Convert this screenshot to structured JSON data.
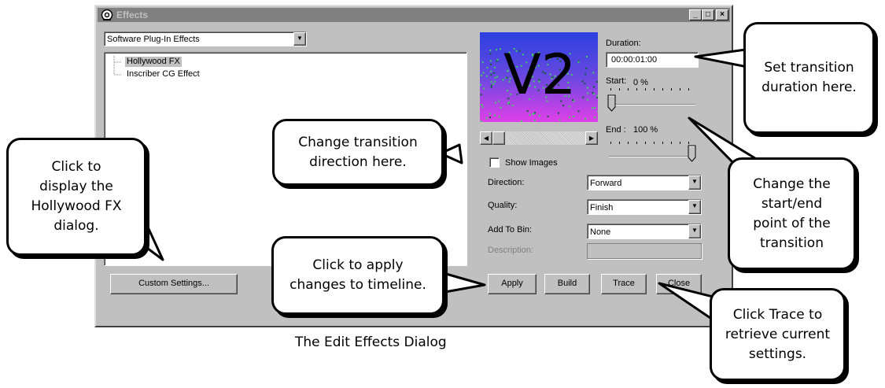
{
  "window": {
    "title": "Effects",
    "caption_buttons": {
      "minimize": "_",
      "maximize": "□",
      "close": "×"
    }
  },
  "plugin_select": {
    "value": "Software Plug-In Effects"
  },
  "tree": {
    "items": [
      "Hollywood FX",
      "Inscriber CG Effect"
    ],
    "selected": "Hollywood FX"
  },
  "preview": {
    "text": "V2"
  },
  "duration": {
    "label": "Duration:",
    "value": "00:00:01:00"
  },
  "start": {
    "label": "Start:",
    "value": "0 %",
    "level": 0
  },
  "end": {
    "label": "End :",
    "value": "100 %",
    "level": 1
  },
  "show_images": {
    "label": "Show Images",
    "checked": false
  },
  "direction": {
    "label": "Direction:",
    "value": "Forward"
  },
  "quality": {
    "label": "Quality:",
    "value": "Finish"
  },
  "add_to_bin": {
    "label": "Add To Bin:",
    "value": "None"
  },
  "description": {
    "label": "Description:",
    "value": ""
  },
  "buttons": {
    "custom_settings": "Custom Settings...",
    "apply": "Apply",
    "build": "Build",
    "trace": "Trace",
    "close": "Close"
  },
  "callouts": {
    "duration": "Set transition\nduration here.",
    "direction": "Change transition\ndirection here.",
    "hollywood": "Click to\ndisplay the\nHollywood FX\ndialog.",
    "apply": "Click to apply\nchanges to timeline.",
    "startend": "Change the\nstart/end\npoint of the\ntransition",
    "trace": "Click Trace to\nretrieve current\nsettings."
  },
  "caption": "The Edit Effects Dialog"
}
